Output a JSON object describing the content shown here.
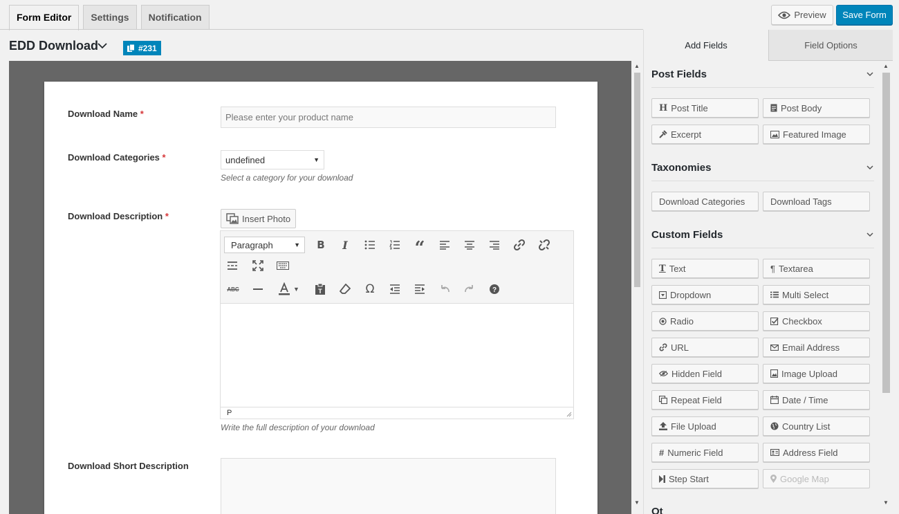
{
  "tabs": [
    "Form Editor",
    "Settings",
    "Notification"
  ],
  "header": {
    "preview": "Preview",
    "save": "Save Form",
    "form_title": "EDD Download",
    "form_id": "#231"
  },
  "form": {
    "name_label": "Download Name",
    "name_placeholder": "Please enter your product name",
    "cat_label": "Download Categories",
    "cat_value": "undefined",
    "cat_help": "Select a category for your download",
    "desc_label": "Download Description",
    "insert_photo": "Insert Photo",
    "paragraph": "Paragraph",
    "status_path": "P",
    "desc_help": "Write the full description of your download",
    "short_label": "Download Short Description",
    "required_mark": "*"
  },
  "panel": {
    "tab_add": "Add Fields",
    "tab_options": "Field Options",
    "sections": [
      "Post Fields",
      "Taxonomies",
      "Custom Fields"
    ],
    "post_fields": [
      "Post Title",
      "Post Body",
      "Excerpt",
      "Featured Image"
    ],
    "taxonomies": [
      "Download Categories",
      "Download Tags"
    ],
    "custom_fields": [
      "Text",
      "Textarea",
      "Dropdown",
      "Multi Select",
      "Radio",
      "Checkbox",
      "URL",
      "Email Address",
      "Hidden Field",
      "Image Upload",
      "Repeat Field",
      "Date / Time",
      "File Upload",
      "Country List",
      "Numeric Field",
      "Address Field",
      "Step Start",
      "Google Map"
    ],
    "next_section_partial": "Ot"
  },
  "colors": {
    "accent": "#0085ba",
    "required": "#d63638",
    "canvas": "#666666"
  }
}
